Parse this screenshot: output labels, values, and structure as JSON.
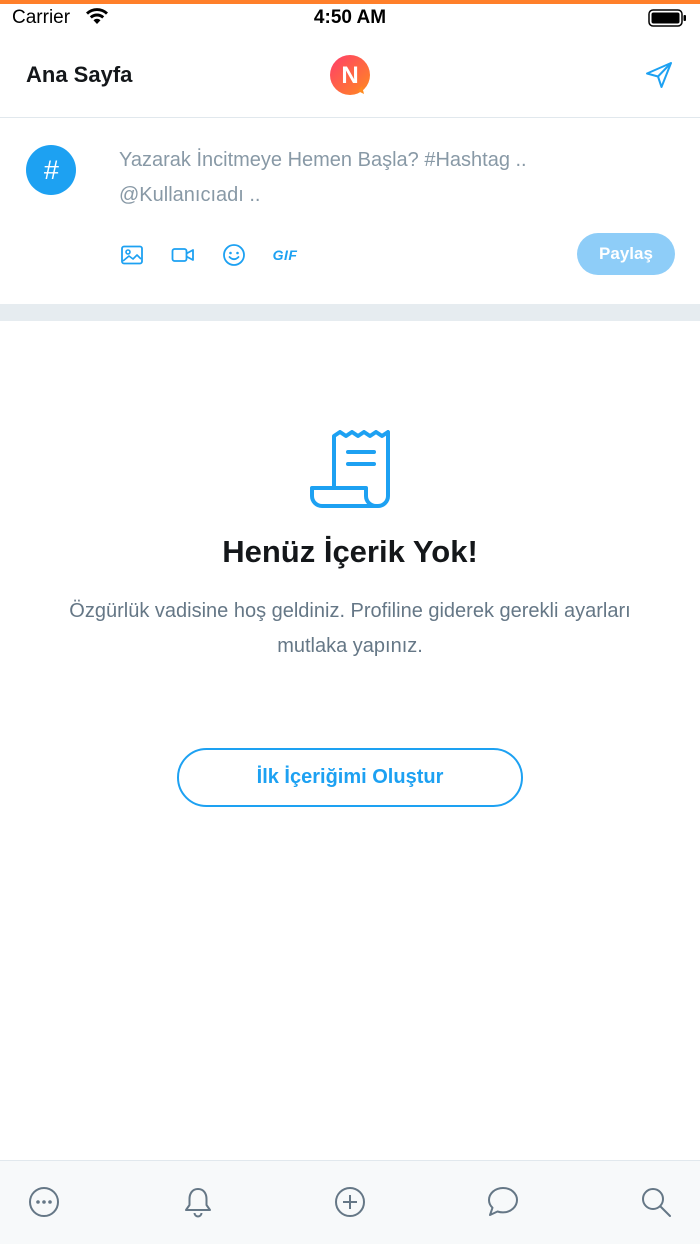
{
  "status_bar": {
    "carrier": "Carrier",
    "time": "4:50 AM"
  },
  "nav": {
    "title": "Ana Sayfa",
    "logo_letter": "N"
  },
  "composer": {
    "avatar_symbol": "#",
    "placeholder": "Yazarak İncitmeye Hemen Başla? #Hashtag .. @Kullanıcıadı ..",
    "tools": [
      "image-icon",
      "video-icon",
      "emoji-icon",
      "gif-icon"
    ],
    "gif_label": "GIF",
    "share_label": "Paylaş"
  },
  "empty_state": {
    "icon": "receipt-icon",
    "title": "Henüz İçerik Yok!",
    "description": "Özgürlük vadisine hoş geldiniz. Profiline giderek gerekli ayarları mutlaka yapınız.",
    "button_label": "İlk İçeriğimi Oluştur"
  },
  "tab_bar": {
    "items": [
      "more-icon",
      "bell-icon",
      "add-icon",
      "messages-icon",
      "search-icon"
    ]
  },
  "colors": {
    "accent": "#1da1f2",
    "accent_light": "#8ecdf8",
    "top_line": "#ff7f2a",
    "text_primary": "#14171a",
    "text_secondary": "#657786"
  }
}
